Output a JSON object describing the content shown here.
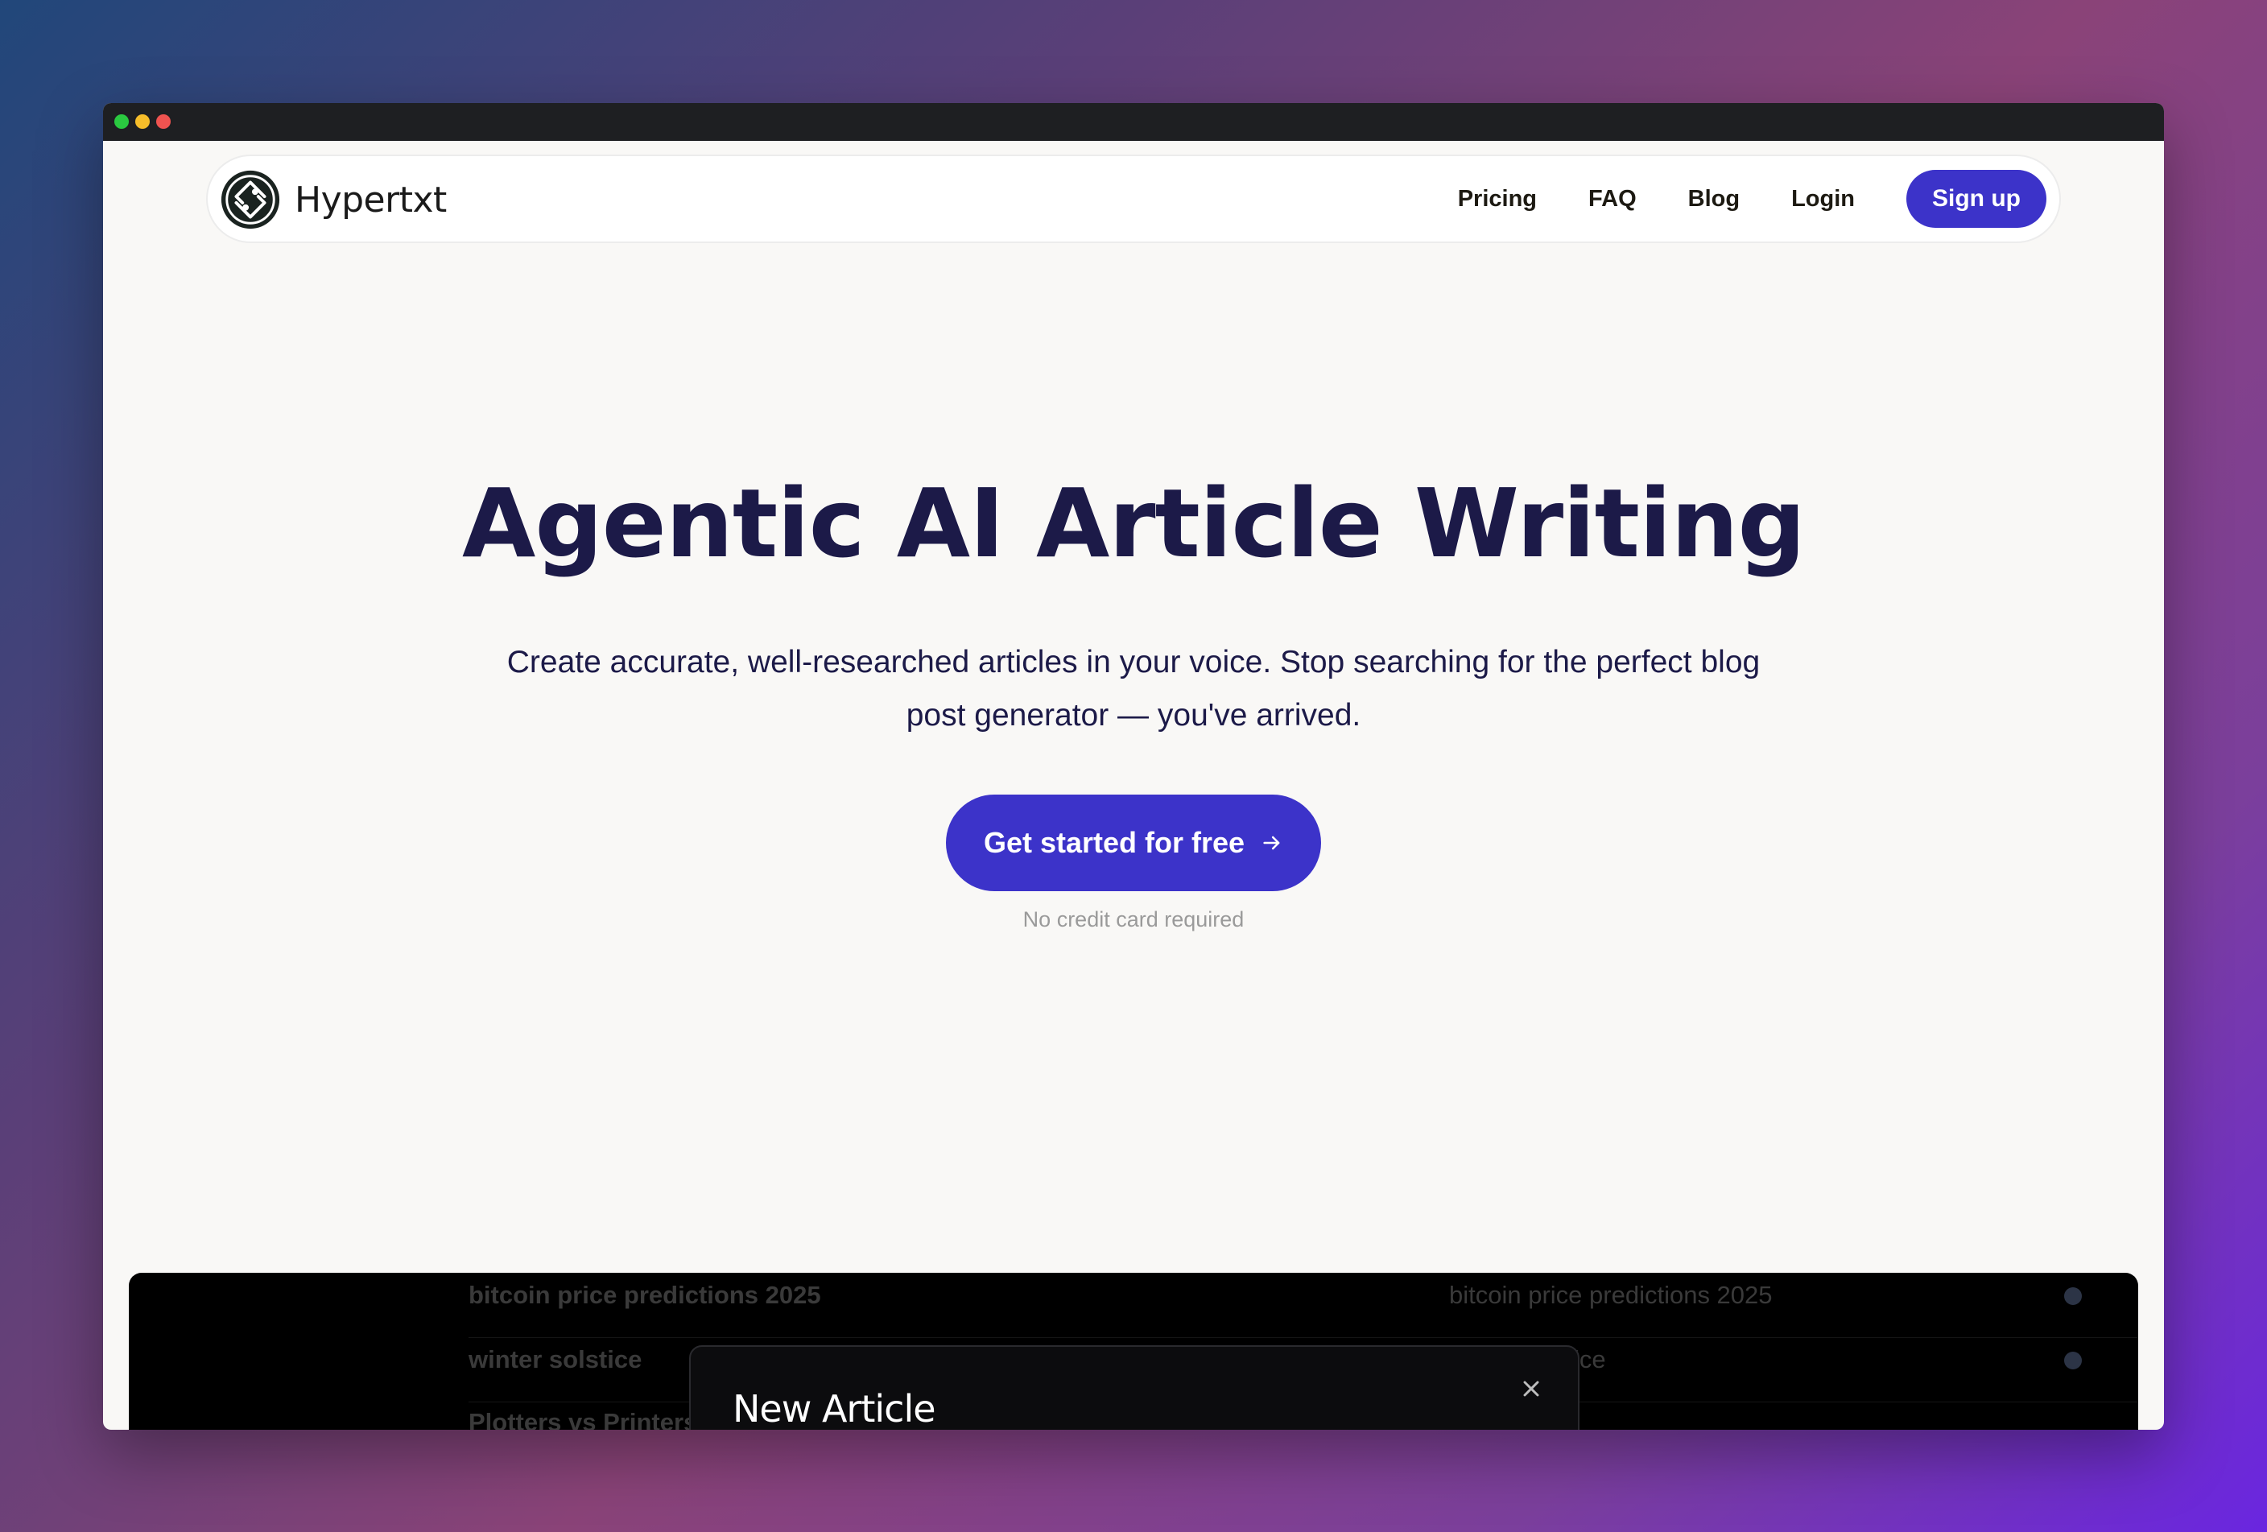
{
  "brand": {
    "name": "Hypertxt"
  },
  "nav": {
    "links": [
      "Pricing",
      "FAQ",
      "Blog",
      "Login"
    ],
    "signup_label": "Sign up"
  },
  "hero": {
    "title": "Agentic AI Article Writing",
    "subtitle": "Create accurate, well-researched articles in your voice. Stop searching for the perfect blog post generator — you've arrived.",
    "cta_label": "Get started for free",
    "note": "No credit card required"
  },
  "preview": {
    "rows": [
      {
        "title": "bitcoin price predictions 2025",
        "keyword": "bitcoin price predictions 2025"
      },
      {
        "title": "winter solstice",
        "keyword": "winter solstice"
      },
      {
        "title": "Plotters vs Printers",
        "keyword": ""
      }
    ],
    "modal": {
      "title": "New Article"
    }
  },
  "colors": {
    "accent": "#3c33c9",
    "heading": "#1c1a48",
    "page_bg": "#f9f8f6"
  }
}
